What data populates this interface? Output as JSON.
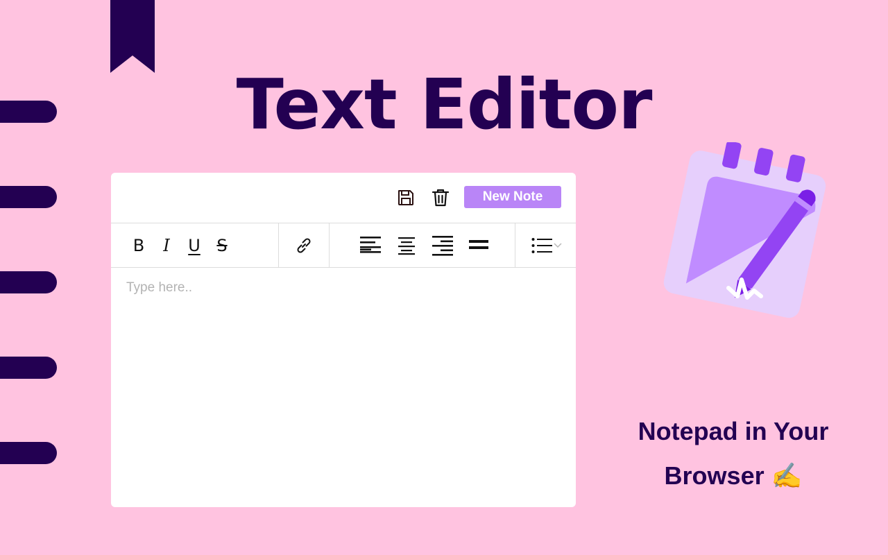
{
  "colors": {
    "background": "#ffc3e0",
    "dark_purple": "#230052",
    "accent_purple": "#b985f7",
    "notepad_light": "#e6cffc",
    "notepad_mid": "#c08cff",
    "pencil": "#9344f3",
    "pencil_dark": "#7a1fe6",
    "white": "#ffffff"
  },
  "hero": {
    "title": "Text Editor"
  },
  "editor": {
    "header": {
      "save_icon": "floppy-disk-icon",
      "delete_icon": "trash-icon",
      "new_note_label": "New Note"
    },
    "toolbar": {
      "bold_label": "B",
      "italic_label": "I",
      "underline_label": "U",
      "strike_label": "S",
      "link_icon": "link-icon",
      "align_icons": [
        "align-left-icon",
        "align-center-icon",
        "align-right-icon",
        "align-justify-icon"
      ],
      "list_icon": "bulleted-list-icon",
      "dropdown_icon": "chevron-down-icon"
    },
    "body": {
      "placeholder": "Type here.."
    }
  },
  "tagline": {
    "line1": "Notepad in Your",
    "line2": "Browser ✍️"
  },
  "decor": {
    "bookmark_icon": "bookmark-icon",
    "binder_tab_count": 5,
    "illustration_icon": "notepad-pencil-icon"
  }
}
